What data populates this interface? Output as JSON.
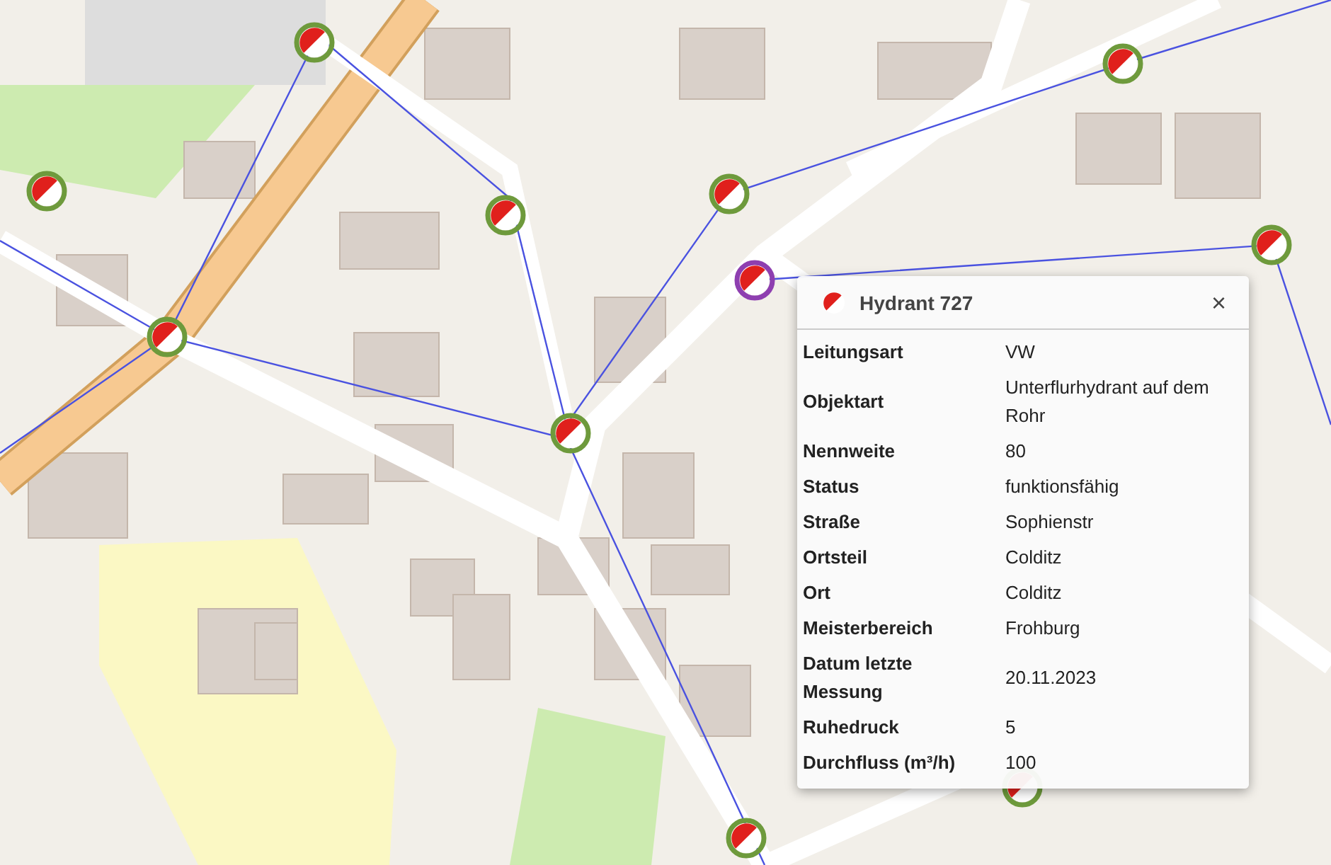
{
  "markers": [
    {
      "selected": false
    },
    {
      "selected": false
    },
    {
      "selected": false
    },
    {
      "selected": false
    },
    {
      "selected": false
    },
    {
      "selected": false
    },
    {
      "selected": true
    },
    {
      "selected": false
    },
    {
      "selected": false
    },
    {
      "selected": false
    },
    {
      "selected": false
    }
  ],
  "popup": {
    "title": "Hydrant 727",
    "close": "×",
    "rows": [
      {
        "label": "Leitungsart",
        "value": "VW"
      },
      {
        "label": "Objektart",
        "value": "Unterflurhydrant auf dem Rohr"
      },
      {
        "label": "Nennweite",
        "value": "80"
      },
      {
        "label": "Status",
        "value": "funktionsfähig"
      },
      {
        "label": "Straße",
        "value": "Sophienstr"
      },
      {
        "label": "Ortsteil",
        "value": "Colditz"
      },
      {
        "label": "Ort",
        "value": "Colditz"
      },
      {
        "label": "Meisterbereich",
        "value": "Frohburg"
      },
      {
        "label": "Datum letzte Messung",
        "value": "20.11.2023"
      },
      {
        "label": "Ruhedruck",
        "value": "5"
      },
      {
        "label": "Durchfluss (m³/h)",
        "value": "100"
      }
    ]
  }
}
